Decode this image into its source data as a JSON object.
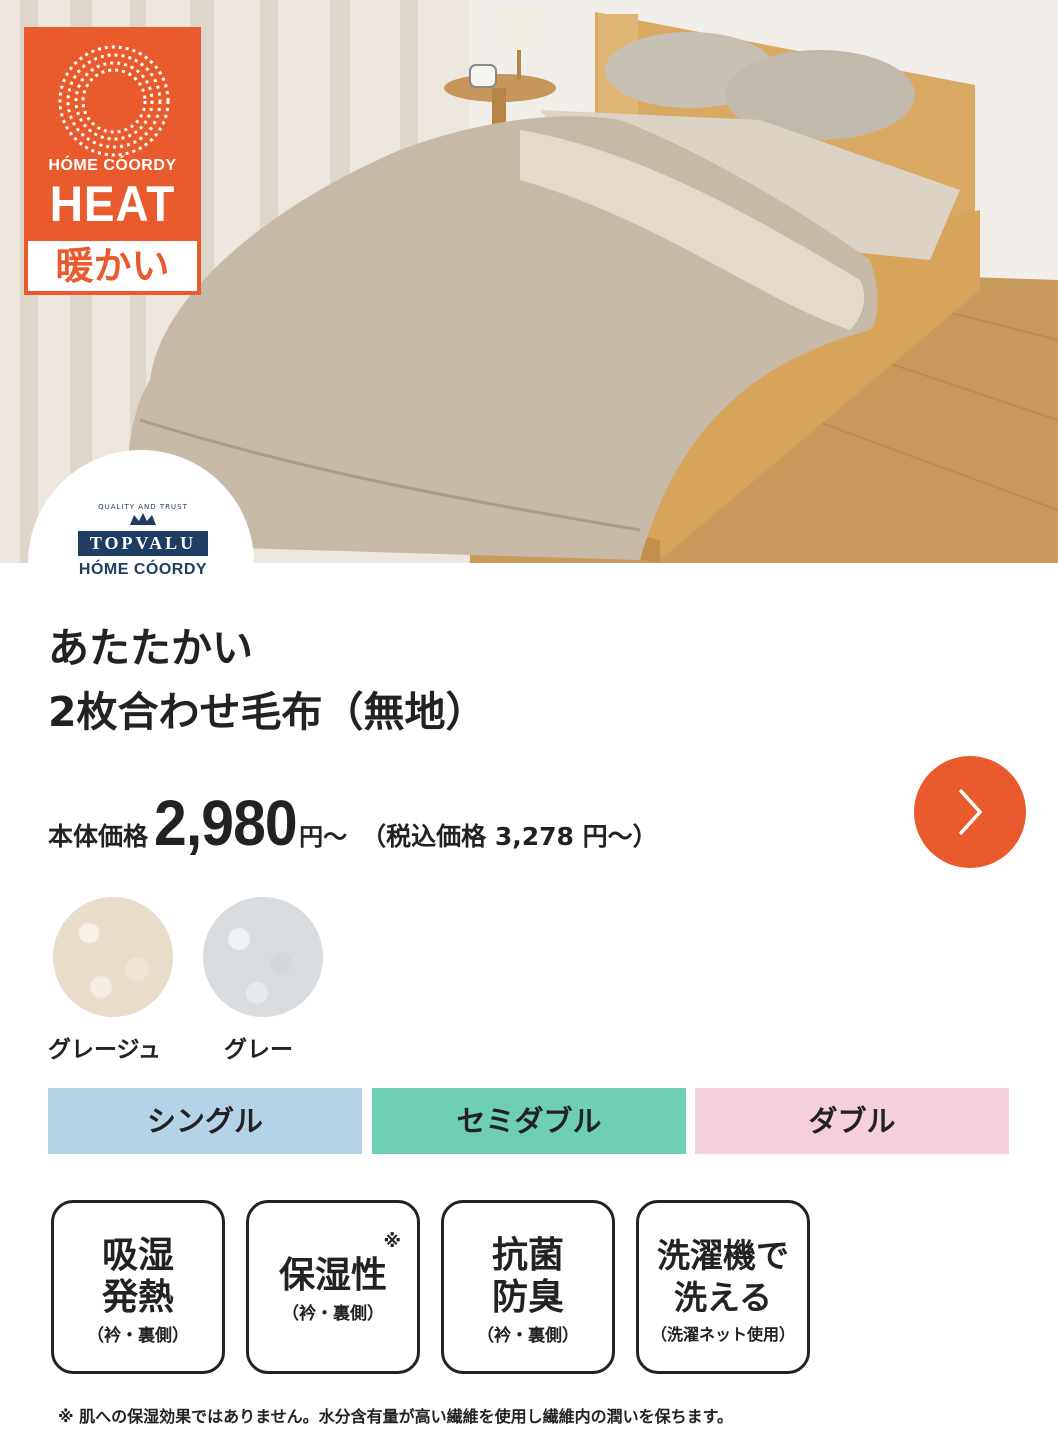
{
  "badge": {
    "brand": "HÓME CÓORDY",
    "heat": "HEAT",
    "warm": "暖かい"
  },
  "topvalu": {
    "quality": "QUALITY AND TRUST",
    "name": "TOPVALU",
    "line": "HÓME CÓORDY"
  },
  "product": {
    "title_line1": "あたたかい",
    "title_line2": "2枚合わせ毛布（無地）"
  },
  "price": {
    "label": "本体価格",
    "value": "2,980",
    "unit": "円〜",
    "tax_text": "（税込価格 3,278 円〜）"
  },
  "colors": [
    {
      "name": "グレージュ"
    },
    {
      "name": "グレー"
    }
  ],
  "sizes": [
    {
      "label": "シングル",
      "color": "#b5d3e6"
    },
    {
      "label": "セミダブル",
      "color": "#6fcfb5"
    },
    {
      "label": "ダブル",
      "color": "#f4d0da"
    }
  ],
  "features": [
    {
      "main": "吸湿\n発熱",
      "sub": "（衿・裏側）",
      "mark": ""
    },
    {
      "main": "保湿性",
      "sub": "（衿・裏側）",
      "mark": "※"
    },
    {
      "main": "抗菌\n防臭",
      "sub": "（衿・裏側）",
      "mark": ""
    },
    {
      "main": "洗濯機で\n洗える",
      "sub": "（洗濯ネット使用）",
      "mark": ""
    }
  ],
  "footnote": "※ 肌への保湿効果ではありません。水分含有量が高い繊維を使用し繊維内の潤いを保ちます。",
  "accent_color": "#e95a2c",
  "icons": {
    "next": "chevron-right-icon",
    "sun": "sun-rays-icon"
  }
}
